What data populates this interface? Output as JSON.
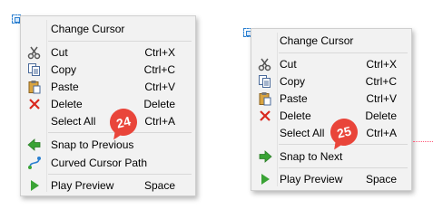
{
  "menu_left": {
    "items": [
      {
        "label": "Change Cursor",
        "shortcut": "",
        "icon": "none"
      },
      {
        "label": "Cut",
        "shortcut": "Ctrl+X",
        "icon": "scissors-icon"
      },
      {
        "label": "Copy",
        "shortcut": "Ctrl+C",
        "icon": "copy-icon"
      },
      {
        "label": "Paste",
        "shortcut": "Ctrl+V",
        "icon": "paste-icon"
      },
      {
        "label": "Delete",
        "shortcut": "Delete",
        "icon": "delete-x-icon"
      },
      {
        "label": "Select All",
        "shortcut": "Ctrl+A",
        "icon": "none"
      },
      {
        "label": "Snap to Previous",
        "shortcut": "",
        "icon": "arrow-left-icon"
      },
      {
        "label": "Curved Cursor Path",
        "shortcut": "",
        "icon": "curved-path-icon"
      },
      {
        "label": "Play Preview",
        "shortcut": "Space",
        "icon": "play-icon"
      }
    ],
    "badge": "24"
  },
  "menu_right": {
    "items": [
      {
        "label": "Change Cursor",
        "shortcut": "",
        "icon": "none"
      },
      {
        "label": "Cut",
        "shortcut": "Ctrl+X",
        "icon": "scissors-icon"
      },
      {
        "label": "Copy",
        "shortcut": "Ctrl+C",
        "icon": "copy-icon"
      },
      {
        "label": "Paste",
        "shortcut": "Ctrl+V",
        "icon": "paste-icon"
      },
      {
        "label": "Delete",
        "shortcut": "Delete",
        "icon": "delete-x-icon"
      },
      {
        "label": "Select All",
        "shortcut": "Ctrl+A",
        "icon": "none"
      },
      {
        "label": "Snap to Next",
        "shortcut": "",
        "icon": "arrow-right-icon"
      },
      {
        "label": "Play Preview",
        "shortcut": "Space",
        "icon": "play-icon"
      }
    ],
    "badge": "25"
  },
  "colors": {
    "badge": "#e9453a",
    "menu_bg": "#f2f2f2",
    "snap_green": "#3aa335",
    "delete_red": "#d9281e"
  }
}
